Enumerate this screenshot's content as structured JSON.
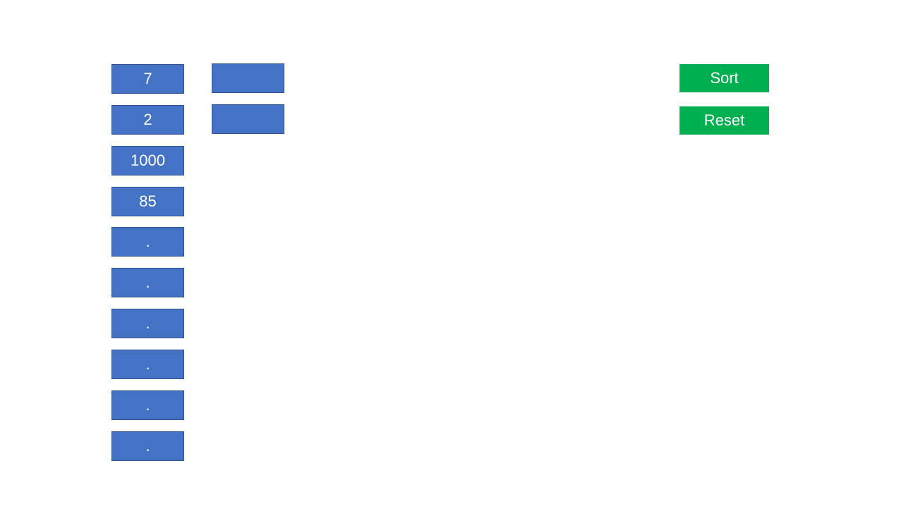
{
  "colors": {
    "cell_fill": "#4472C4",
    "cell_border": "#2F528F",
    "button_fill": "#00B050",
    "text": "#FFFFFF",
    "background": "#FFFFFF"
  },
  "input_list": {
    "items": [
      "7",
      "2",
      "1000",
      "85",
      ".",
      ".",
      ".",
      ".",
      ".",
      "."
    ]
  },
  "output_list": {
    "items": [
      "",
      ""
    ]
  },
  "controls": {
    "sort_label": "Sort",
    "reset_label": "Reset"
  }
}
